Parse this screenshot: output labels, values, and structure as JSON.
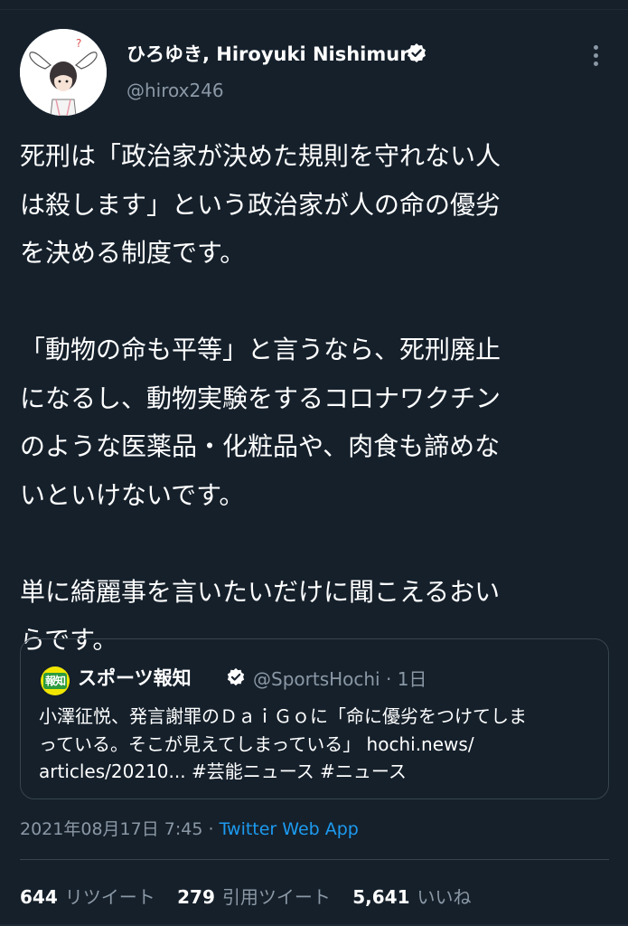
{
  "author": {
    "name": "ひろゆき, Hiroyuki Nishimura",
    "handle": "@hirox246",
    "verified": true
  },
  "tweet": {
    "lines": [
      "死刑は「政治家が決めた規則を守れない人",
      "は殺します」という政治家が人の命の優劣",
      "を決める制度です。",
      "",
      "「動物の命も平等」と言うなら、死刑廃止",
      "になるし、動物実験をするコロナワクチン",
      "のような医薬品・化粧品や、肉食も諦めな",
      "いといけないです。",
      "",
      "単に綺麗事を言いたいだけに聞こえるおい",
      "らです。"
    ]
  },
  "quote": {
    "avatar_text": "報知",
    "name": "スポーツ報知",
    "handle": "@SportsHochi",
    "time": "1日",
    "lines": [
      "小澤征悦、発言謝罪のＤａｉＧｏに「命に優劣をつけてしま",
      "っている。そこが見えてしまっている」 hochi.news/",
      "articles/20210... #芸能ニュース #ニュース"
    ]
  },
  "meta": {
    "timestamp": "2021年08月17日 7:45",
    "separator": "·",
    "source": "Twitter Web App"
  },
  "stats": {
    "retweets": {
      "count": "644",
      "label": "リツイート"
    },
    "quotes": {
      "count": "279",
      "label": "引用ツイート"
    },
    "likes": {
      "count": "5,641",
      "label": "いいね"
    }
  },
  "colors": {
    "background": "#15202b",
    "text": "#ffffff",
    "muted": "#8b98a5",
    "link": "#1d9bf0",
    "border": "#38444d"
  }
}
